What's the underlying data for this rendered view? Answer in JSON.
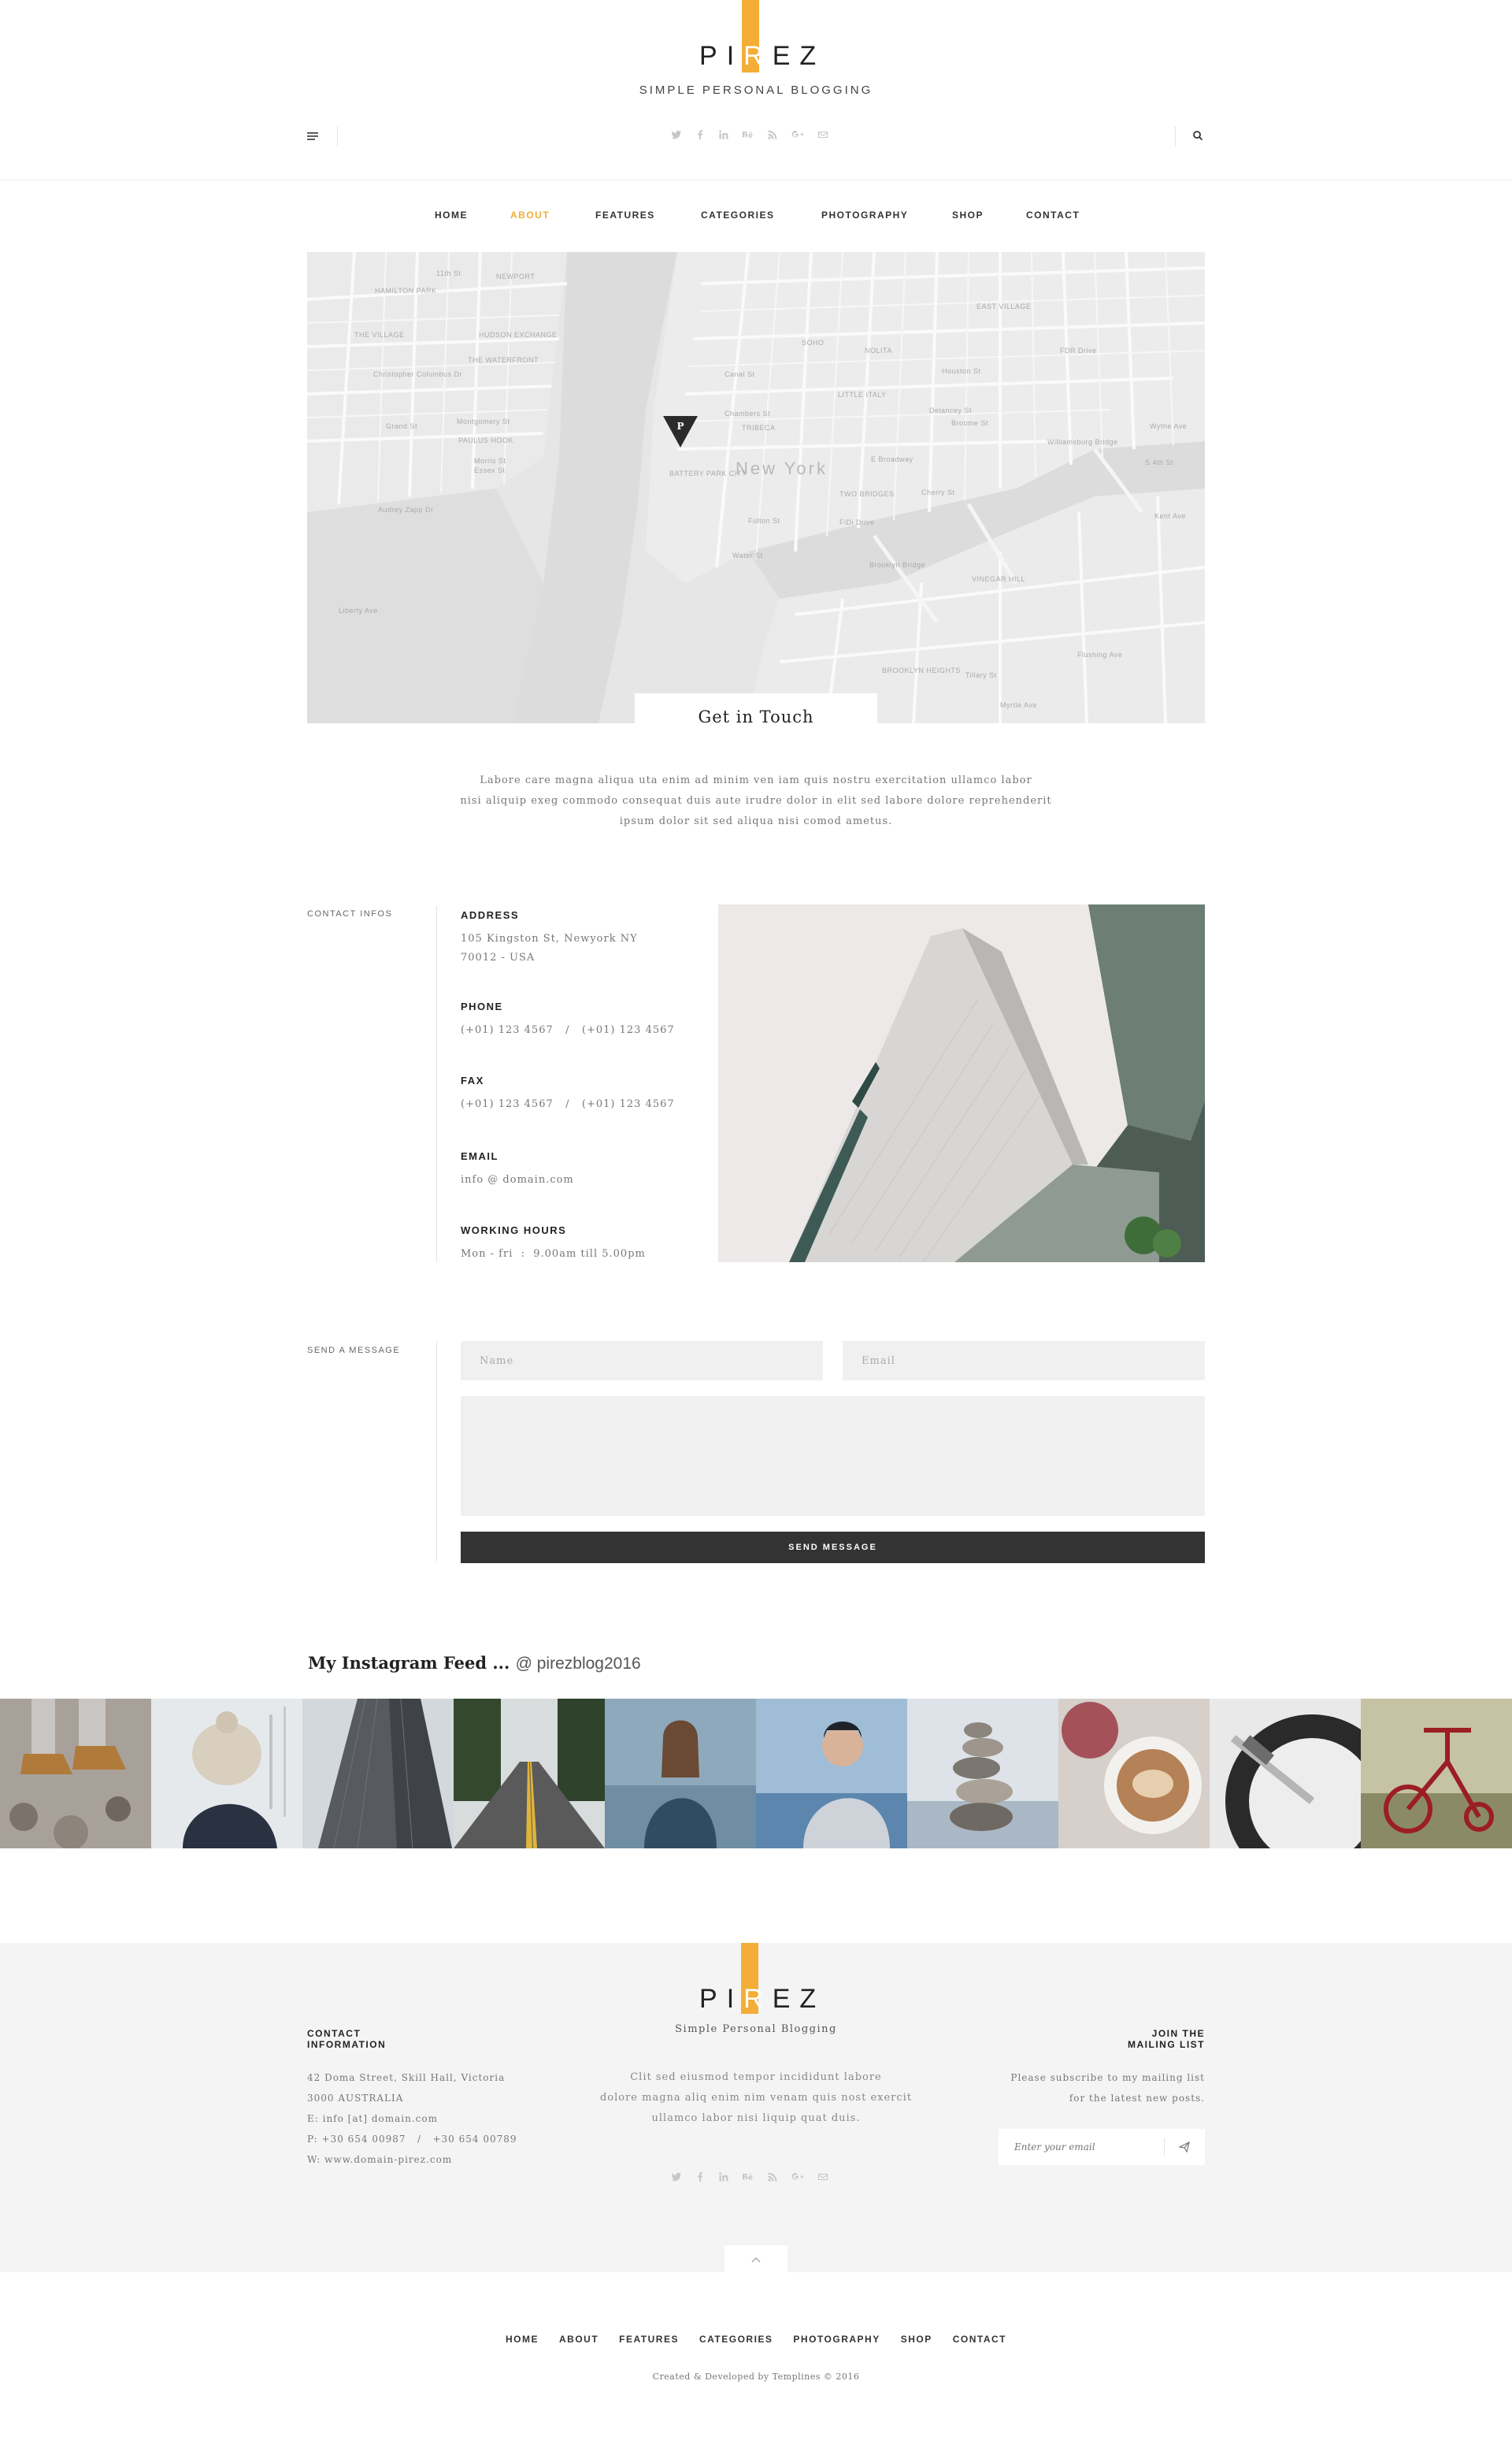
{
  "brand": {
    "logo_letters": [
      "P",
      "I",
      "R",
      "E",
      "Z"
    ],
    "tagline": "SIMPLE PERSONAL BLOGGING",
    "accent_color": "#f4ad36"
  },
  "topbar": {
    "menu_icon": "hamburger-icon",
    "search_icon": "search-icon",
    "social": [
      "twitter-icon",
      "facebook-icon",
      "linkedin-icon",
      "behance-icon",
      "rss-icon",
      "google-plus-icon",
      "email-icon"
    ]
  },
  "nav": {
    "items": [
      "HOME",
      "ABOUT",
      "FEATURES",
      "CATEGORIES",
      "PHOTOGRAPHY",
      "SHOP",
      "CONTACT"
    ],
    "active": "ABOUT"
  },
  "map": {
    "city_label": "New York",
    "pin_label": "P",
    "street_labels": [
      "HAMILTON PARK",
      "11th St",
      "NEWPORT",
      "THE VILLAGE",
      "HUDSON EXCHANGE",
      "THE WATERFRONT",
      "Christopher Columbus Dr",
      "Grand St",
      "Montgomery St",
      "PAULUS HOOK",
      "Morris St",
      "Essex St",
      "Audrey Zapp Dr",
      "Liberty Ave",
      "SOHO",
      "NOLITA",
      "EAST VILLAGE",
      "LITTLE ITALY",
      "TRIBECA",
      "BATTERY PARK CITY",
      "E Broadway",
      "TWO BRIDGES",
      "Cherry St",
      "FiDi Drive",
      "Brooklyn Bridge",
      "VINEGAR HILL",
      "BROOKLYN HEIGHTS",
      "Flushing Ave",
      "Tillary St",
      "Myrtle Ave",
      "Houston St",
      "Delancey St",
      "Broome St",
      "Williamsburg Bridge",
      "S 4th St",
      "Wythe Ave",
      "Kent Ave",
      "FDR Drive",
      "Canal St",
      "Chambers St",
      "Fulton St",
      "Water St"
    ]
  },
  "get_in_touch": {
    "title": "Get in Touch",
    "lines": [
      "Labore care magna aliqua uta enim ad minim ven iam quis nostru exercitation ullamco labor",
      "nisi aliquip exeg commodo consequat duis aute irudre dolor in elit sed labore dolore reprehenderit",
      "ipsum dolor sit sed aliqua nisi comod ametus."
    ]
  },
  "contact_infos": {
    "label": "CONTACT INFOS",
    "address_label": "ADDRESS",
    "address_line1": "105 Kingston St, Newyork NY",
    "address_line2": "70012 - USA",
    "phone_label": "PHONE",
    "phone_value": "(+01) 123 4567   /   (+01) 123 4567",
    "fax_label": "FAX",
    "fax_value": "(+01) 123 4567   /   (+01) 123 4567",
    "email_label": "EMAIL",
    "email_value": "info @ domain.com",
    "hours_label": "WORKING HOURS",
    "hours_value": "Mon - fri  :  9.00am till 5.00pm"
  },
  "message_form": {
    "label": "SEND A MESSAGE",
    "name_placeholder": "Name",
    "email_placeholder": "Email",
    "message_placeholder": "",
    "send_label": "SEND MESSAGE"
  },
  "instagram": {
    "title": "My Instagram  Feed  ...",
    "handle": "@ pirezblog2016",
    "photos": [
      "stones-boots",
      "winter-hat",
      "skyscraper",
      "forest-road",
      "woman-sweater",
      "man-lake",
      "stacked-stones",
      "coffee-cups",
      "turntable",
      "red-tricycle"
    ]
  },
  "footer": {
    "contact_head_1": "CONTACT",
    "contact_head_2": "INFORMATION",
    "contact_lines": [
      "42 Doma Street, Skill Hall, Victoria",
      "3000 AUSTRALIA",
      "E: info [at] domain.com",
      "P: +30 654 00987   /   +30 654 00789",
      "W: www.domain-pirez.com"
    ],
    "tagline": "Simple Personal Blogging",
    "about_lines": [
      "Clit sed eiusmod tempor incididunt labore",
      "dolore magna aliq enim nim venam quis nost exercit",
      "ullamco labor nisi liquip quat duis."
    ],
    "join_head_1": "JOIN THE",
    "join_head_2": "MAILING LIST",
    "join_lines": [
      "Please subscribe to my mailing list",
      "for the latest new posts."
    ],
    "subscribe_placeholder": "Enter your email",
    "top_icon": "chevron-up-icon",
    "nav_items": [
      "HOME",
      "ABOUT",
      "FEATURES",
      "CATEGORIES",
      "PHOTOGRAPHY",
      "SHOP",
      "CONTACT"
    ],
    "credit": "Created & Developed by Templines © 2016"
  }
}
